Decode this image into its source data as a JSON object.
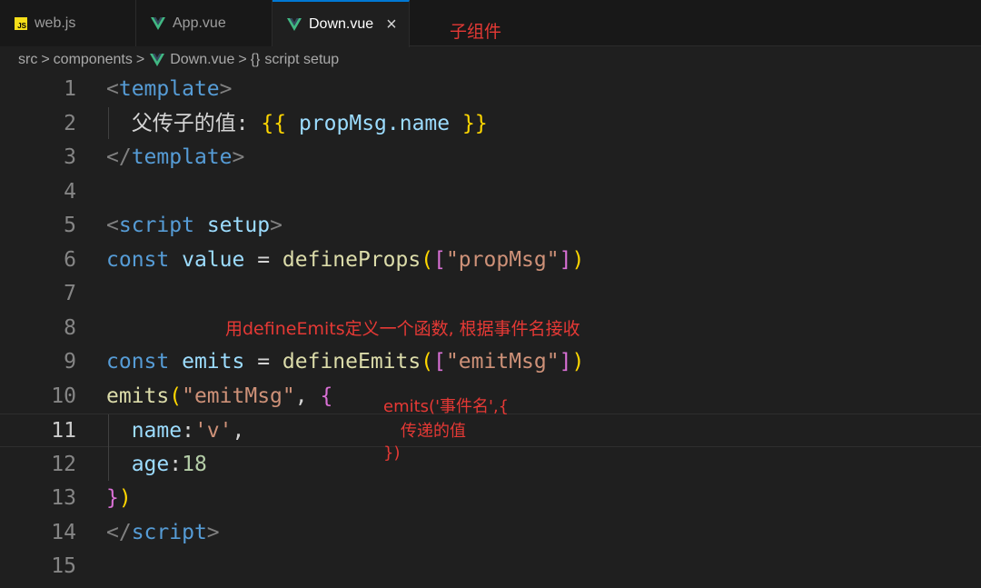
{
  "tabs": [
    {
      "label": "web.js",
      "icon": "js-file-icon"
    },
    {
      "label": "App.vue",
      "icon": "vue-file-icon"
    },
    {
      "label": "Down.vue",
      "icon": "vue-file-icon",
      "active": true
    }
  ],
  "close_glyph": "×",
  "annotation_top": "子组件",
  "breadcrumb": {
    "items": [
      "src",
      "components",
      "Down.vue",
      "script setup"
    ],
    "braces": "{}",
    "separator": ">"
  },
  "line_numbers": [
    "1",
    "2",
    "3",
    "4",
    "5",
    "6",
    "7",
    "8",
    "9",
    "10",
    "11",
    "12",
    "13",
    "14",
    "15"
  ],
  "current_line": "11",
  "code": {
    "l1": {
      "open": "<",
      "tag": "template",
      "close": ">"
    },
    "l2": {
      "indent": "  ",
      "text": "父传子的值: ",
      "b_open": "{{",
      "expr": " propMsg.name ",
      "b_close": "}}"
    },
    "l3": {
      "open": "</",
      "tag": "template",
      "close": ">"
    },
    "l5": {
      "open": "<",
      "tag": "script",
      "sp": " ",
      "attr": "setup",
      "close": ">"
    },
    "l6": {
      "kw": "const",
      "sp1": " ",
      "var": "value",
      "eq": " = ",
      "fn": "defineProps",
      "p1": "(",
      "p2": "[",
      "str": "\"propMsg\"",
      "p3": "]",
      "p4": ")"
    },
    "l9": {
      "kw": "const",
      "sp1": " ",
      "var": "emits",
      "eq": " = ",
      "fn": "defineEmits",
      "p1": "(",
      "p2": "[",
      "str": "\"emitMsg\"",
      "p3": "]",
      "p4": ")"
    },
    "l10": {
      "fn": "emits",
      "p1": "(",
      "str": "\"emitMsg\"",
      "comma": ", ",
      "brace": "{"
    },
    "l11": {
      "indent": "  ",
      "prop": "name",
      "colon": ":",
      "str": "'v'",
      "comma": ","
    },
    "l12": {
      "indent": "  ",
      "prop": "age",
      "colon": ":",
      "num": "18"
    },
    "l13": {
      "brace": "}",
      "p": ")"
    },
    "l14": {
      "open": "</",
      "tag": "script",
      "close": ">"
    }
  },
  "annotations": {
    "define_emits": "用defineEmits定义一个函数, 根据事件名接收",
    "emit_line1": "emits('事件名',{",
    "emit_line2": "传递的值",
    "emit_line3": "})"
  },
  "colors": {
    "accent": "#0078d4",
    "annotation": "#e53935",
    "vue": "#41b883",
    "js": "#f5de19"
  }
}
